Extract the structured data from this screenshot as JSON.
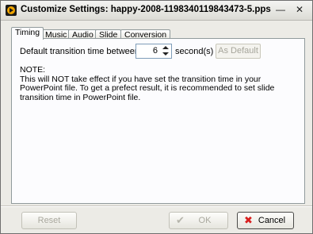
{
  "window": {
    "title": "Customize Settings: happy-2008-1198340119843473-5.pps",
    "minimize_glyph": "—",
    "close_glyph": "✕"
  },
  "tabs": [
    {
      "label": "Timing",
      "active": true
    },
    {
      "label": "Music",
      "active": false
    },
    {
      "label": "Audio",
      "active": false
    },
    {
      "label": "Slide",
      "active": false
    },
    {
      "label": "Conversion",
      "active": false
    }
  ],
  "timing": {
    "transition_label": "Default transition time between slides:",
    "transition_value": "6",
    "unit_label": "second(s)",
    "as_default_label": "As Default",
    "note_title": "NOTE:",
    "note_text": "This will NOT take effect if you have set the transition time in your PowerPoint file. To get a prefect result, it is recommended to set slide transition time in PowerPoint file."
  },
  "buttons": {
    "reset": "Reset",
    "ok": "OK",
    "cancel": "Cancel"
  },
  "icons": {
    "app": "app-logo-icon",
    "ok": "check-icon",
    "cancel": "x-icon",
    "spin_up": "arrow-up-icon",
    "spin_down": "arrow-down-icon"
  }
}
